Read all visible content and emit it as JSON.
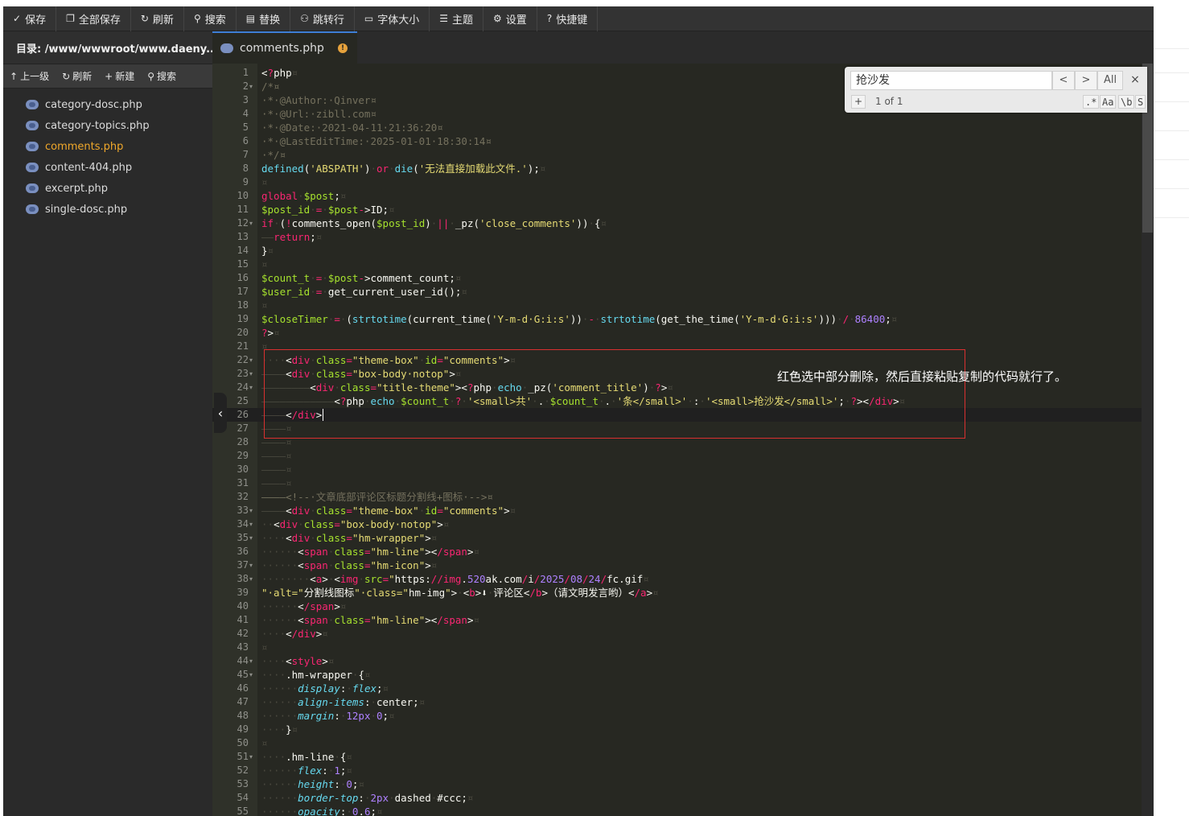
{
  "toolbar": [
    {
      "icon": "✓",
      "label": "保存",
      "name": "save-button"
    },
    {
      "icon": "❐",
      "label": "全部保存",
      "name": "save-all-button"
    },
    {
      "icon": "↻",
      "label": "刷新",
      "name": "refresh-button"
    },
    {
      "icon": "⚲",
      "label": "搜索",
      "name": "search-button"
    },
    {
      "icon": "▤",
      "label": "替换",
      "name": "replace-button"
    },
    {
      "icon": "⚇",
      "label": "跳转行",
      "name": "goto-line-button"
    },
    {
      "icon": "▭",
      "label": "字体大小",
      "name": "font-size-button"
    },
    {
      "icon": "☰",
      "label": "主题",
      "name": "theme-button"
    },
    {
      "icon": "⚙",
      "label": "设置",
      "name": "settings-button"
    },
    {
      "icon": "?",
      "label": "快捷键",
      "name": "shortcuts-button"
    }
  ],
  "sidebar": {
    "directory_label": "目录: /www/wwwroot/www.daeny...",
    "tools": [
      {
        "icon": "↑",
        "label": "上一级",
        "name": "parent-dir-button"
      },
      {
        "icon": "↻",
        "label": "刷新",
        "name": "sidebar-refresh-button"
      },
      {
        "icon": "+",
        "label": "新建",
        "name": "new-file-button"
      },
      {
        "icon": "⚲",
        "label": "搜索",
        "name": "sidebar-search-button"
      }
    ],
    "files": [
      {
        "name": "category-dosc.php",
        "active": false
      },
      {
        "name": "category-topics.php",
        "active": false
      },
      {
        "name": "comments.php",
        "active": true
      },
      {
        "name": "content-404.php",
        "active": false
      },
      {
        "name": "excerpt.php",
        "active": false
      },
      {
        "name": "single-dosc.php",
        "active": false
      }
    ]
  },
  "tab": {
    "label": "comments.php",
    "badge": "!"
  },
  "search": {
    "query": "抢沙发",
    "prev": "<",
    "next": ">",
    "all": "All",
    "close": "×",
    "plus": "+",
    "count": "1 of 1",
    "opts": [
      ".*",
      "Aa",
      "\\b",
      "S"
    ]
  },
  "annotation": "红色选中部分删除，然后直接粘贴复制的代码就行了。",
  "collapse_icon": "‹",
  "colors": {
    "keyword": "#f92672",
    "string": "#e6db74",
    "variable": "#a6e22e",
    "function": "#66d9ef",
    "comment": "#75715e",
    "number": "#ae81ff"
  },
  "current_line": 26,
  "code_lines": [
    {
      "n": 1,
      "f": false,
      "t": "<?php¤"
    },
    {
      "n": 2,
      "f": true,
      "t": "/*¤"
    },
    {
      "n": 3,
      "f": false,
      "t": "·*·@Author:·Qinver¤"
    },
    {
      "n": 4,
      "f": false,
      "t": "·*·@Url:·zibll.com¤"
    },
    {
      "n": 5,
      "f": false,
      "t": "·*·@Date:·2021-04-11·21:36:20¤"
    },
    {
      "n": 6,
      "f": false,
      "t": "·*·@LastEditTime:·2025-01-01·18:30:14¤"
    },
    {
      "n": 7,
      "f": false,
      "t": "·*/¤"
    },
    {
      "n": 8,
      "f": false,
      "t": "defined('ABSPATH')·or·die('无法直接加载此文件.');¤"
    },
    {
      "n": 9,
      "f": false,
      "t": "¤"
    },
    {
      "n": 10,
      "f": false,
      "t": "global·$post;¤"
    },
    {
      "n": 11,
      "f": false,
      "t": "$post_id·=·$post->ID;¤"
    },
    {
      "n": 12,
      "f": true,
      "t": "if·(!comments_open($post_id)·||·_pz('close_comments'))·{¤"
    },
    {
      "n": 13,
      "f": false,
      "t": "——return;¤"
    },
    {
      "n": 14,
      "f": false,
      "t": "}¤"
    },
    {
      "n": 15,
      "f": false,
      "t": "¤"
    },
    {
      "n": 16,
      "f": false,
      "t": "$count_t·=·$post->comment_count;¤"
    },
    {
      "n": 17,
      "f": false,
      "t": "$user_id·=·get_current_user_id();¤"
    },
    {
      "n": 18,
      "f": false,
      "t": "¤"
    },
    {
      "n": 19,
      "f": false,
      "t": "$closeTimer·=·(strtotime(current_time('Y-m-d·G:i:s'))·-·strtotime(get_the_time('Y-m-d·G:i:s')))·/·86400;¤"
    },
    {
      "n": 20,
      "f": false,
      "t": "?>¤"
    },
    {
      "n": 21,
      "f": false,
      "t": "¤"
    },
    {
      "n": 22,
      "f": true,
      "t": "····<div·class=\"theme-box\"·id=\"comments\">¤"
    },
    {
      "n": 23,
      "f": true,
      "t": "————<div·class=\"box-body·notop\">¤"
    },
    {
      "n": 24,
      "f": true,
      "t": "————————<div·class=\"title-theme\"><?php·echo·_pz('comment_title')·?>¤"
    },
    {
      "n": 25,
      "f": false,
      "t": "————————————<?php·echo·$count_t·?·'<small>共'·.·$count_t·.·'条</small>'·:·'<small>抢沙发</small>';·?></div>¤"
    },
    {
      "n": 26,
      "f": false,
      "t": "————</div>"
    },
    {
      "n": 27,
      "f": false,
      "t": "————¤"
    },
    {
      "n": 28,
      "f": false,
      "t": "————¤"
    },
    {
      "n": 29,
      "f": false,
      "t": "————¤"
    },
    {
      "n": 30,
      "f": false,
      "t": "————¤"
    },
    {
      "n": 31,
      "f": false,
      "t": "————¤"
    },
    {
      "n": 32,
      "f": false,
      "t": "————<!--·文章底部评论区标题分割线+图标·-->¤"
    },
    {
      "n": 33,
      "f": true,
      "t": "————<div·class=\"theme-box\"·id=\"comments\">¤"
    },
    {
      "n": 34,
      "f": true,
      "t": "··<div·class=\"box-body·notop\">¤"
    },
    {
      "n": 35,
      "f": true,
      "t": "····<div·class=\"hm-wrapper\">¤"
    },
    {
      "n": 36,
      "f": false,
      "t": "······<span·class=\"hm-line\"></span>¤"
    },
    {
      "n": 37,
      "f": true,
      "t": "······<span·class=\"hm-icon\">¤"
    },
    {
      "n": 38,
      "f": true,
      "t": "········<a>·<img·src=\"https://img.520ak.com/i/2025/08/24/fc.gif¤"
    },
    {
      "n": 39,
      "f": false,
      "t": "\"·alt=\"分割线图标\"·class=\"hm-img\">·<b>⬇·评论区</b>（请文明发言哟）</a>¤"
    },
    {
      "n": 40,
      "f": false,
      "t": "······</span>¤"
    },
    {
      "n": 41,
      "f": false,
      "t": "······<span·class=\"hm-line\"></span>¤"
    },
    {
      "n": 42,
      "f": false,
      "t": "····</div>¤"
    },
    {
      "n": 43,
      "f": false,
      "t": "¤"
    },
    {
      "n": 44,
      "f": true,
      "t": "····<style>¤"
    },
    {
      "n": 45,
      "f": true,
      "t": "····.hm-wrapper·{¤"
    },
    {
      "n": 46,
      "f": false,
      "t": "······display:·flex;¤"
    },
    {
      "n": 47,
      "f": false,
      "t": "······align-items:·center;¤"
    },
    {
      "n": 48,
      "f": false,
      "t": "······margin:·12px·0;¤"
    },
    {
      "n": 49,
      "f": false,
      "t": "····}¤"
    },
    {
      "n": 50,
      "f": false,
      "t": "¤"
    },
    {
      "n": 51,
      "f": true,
      "t": "····.hm-line·{¤"
    },
    {
      "n": 52,
      "f": false,
      "t": "······flex:·1;¤"
    },
    {
      "n": 53,
      "f": false,
      "t": "······height:·0;¤"
    },
    {
      "n": 54,
      "f": false,
      "t": "······border-top:·2px·dashed·#ccc;¤"
    },
    {
      "n": 55,
      "f": false,
      "t": "······opacity:·0.6;¤"
    }
  ]
}
